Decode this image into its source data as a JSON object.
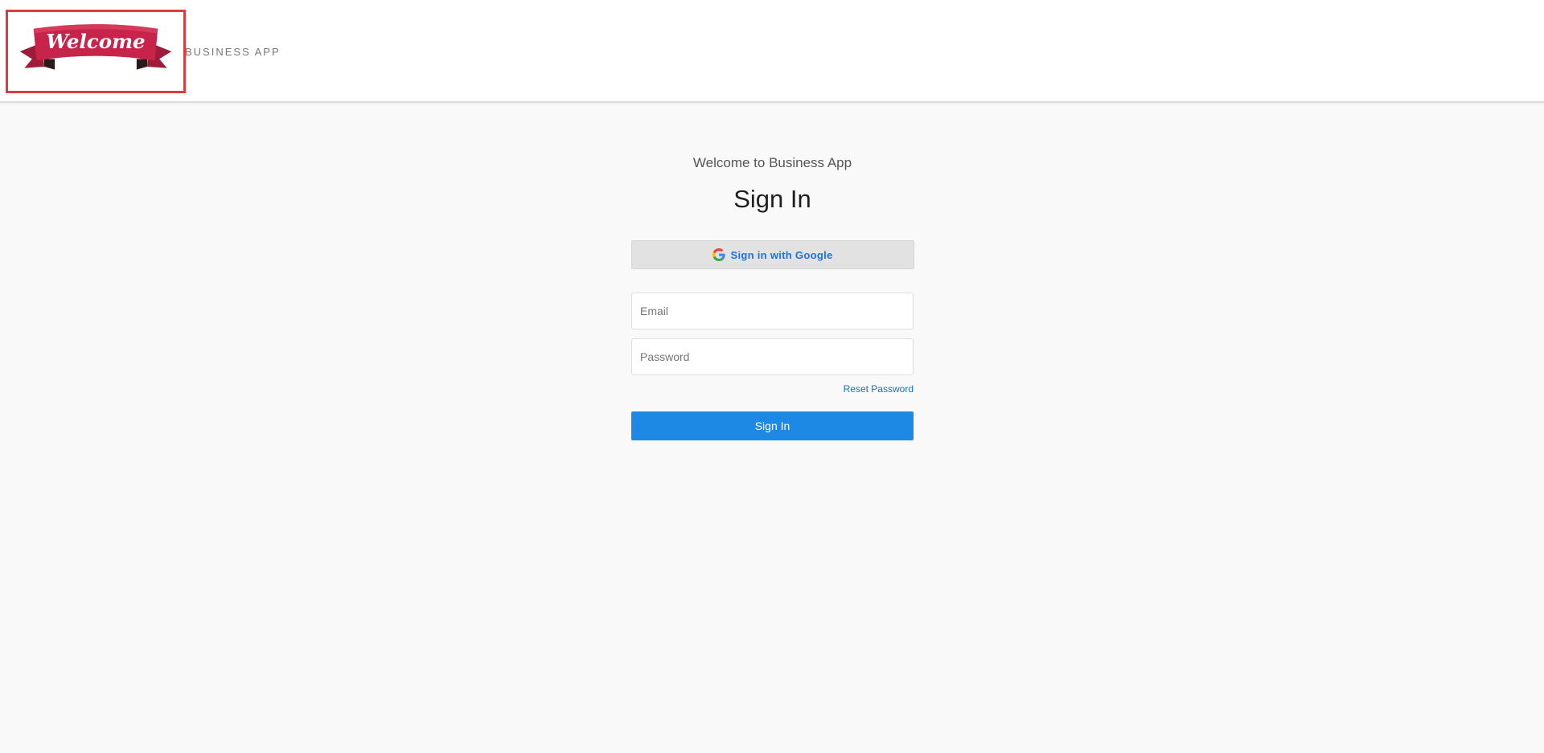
{
  "header": {
    "logo_text": "Welcome",
    "app_name": "BUSINESS APP",
    "logo_border_color": "#e0393e",
    "logo_ribbon_color": "#c8234a"
  },
  "signin": {
    "welcome": "Welcome to Business App",
    "title": "Sign In",
    "google_button": {
      "label": "Sign in with Google",
      "icon": "google-g-icon"
    },
    "email": {
      "value": "",
      "placeholder": "Email"
    },
    "password": {
      "value": "",
      "placeholder": "Password"
    },
    "reset_password_label": "Reset Password",
    "submit_label": "Sign In",
    "accent_color": "#1e88e5"
  }
}
